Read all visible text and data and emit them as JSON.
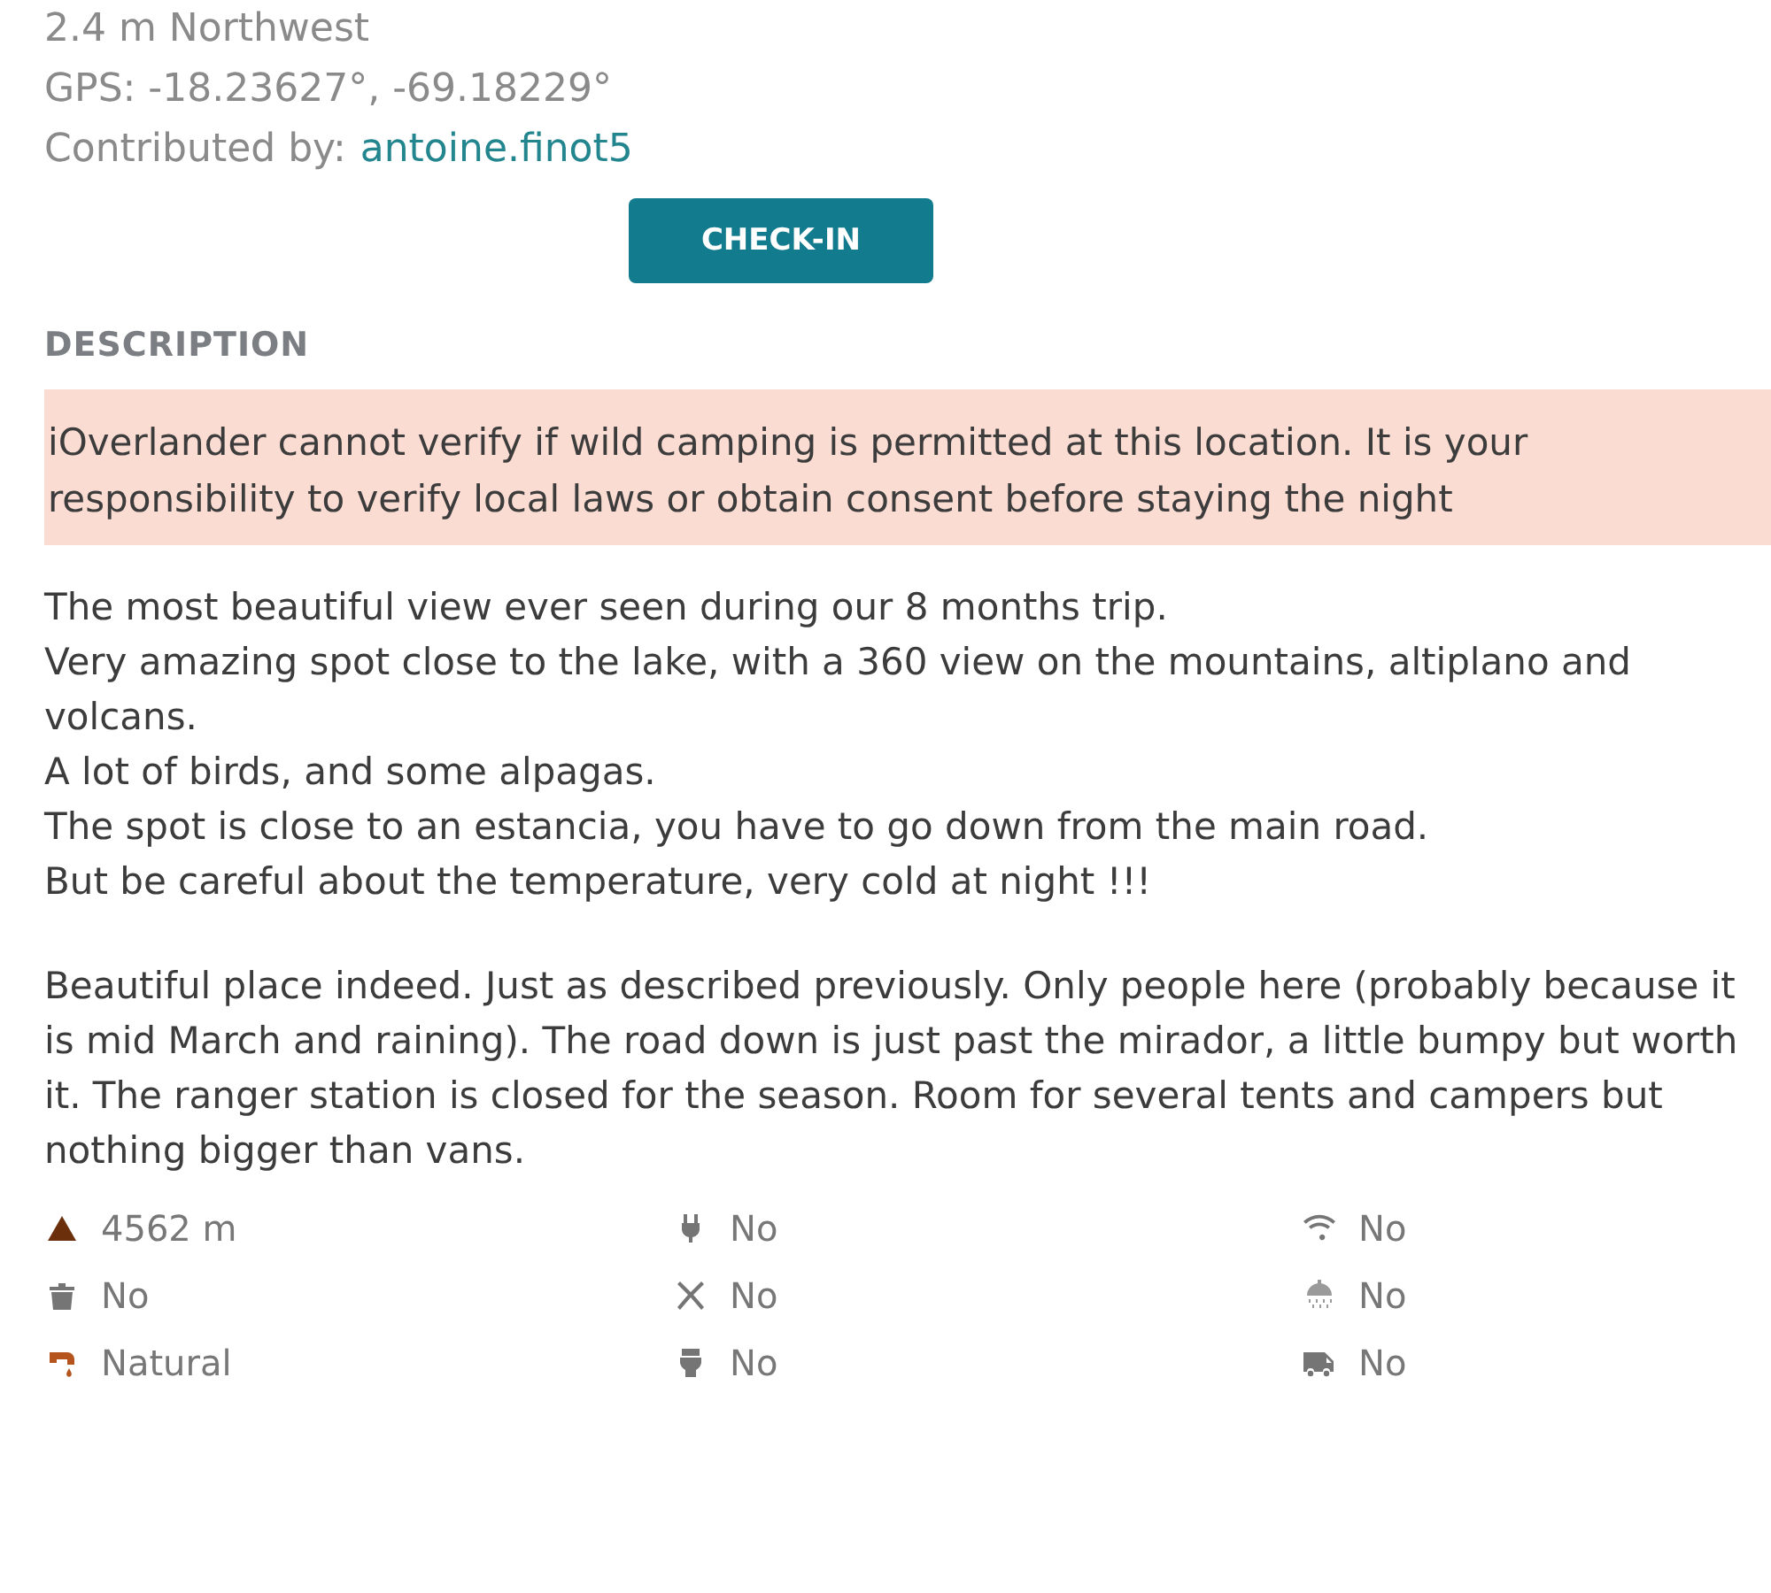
{
  "location": {
    "distance": "2.4 m Northwest",
    "gps": "GPS: -18.23627°, -69.18229°",
    "contributed_label": "Contributed by:",
    "contributor": "antoine.finot5"
  },
  "checkin_button": "CHECK-IN",
  "description_heading": "DESCRIPTION",
  "warning": "iOverlander cannot verify if wild camping is permitted at this location. It is your responsibility to verify local laws or obtain consent before staying the night",
  "description_lines": [
    "The most beautiful view ever seen during our 8 months trip.",
    "Very amazing spot close to the lake, with a 360 view on the mountains, altiplano and volcans.",
    "A lot of birds, and some alpagas.",
    "The spot is close to an estancia, you have to go down from the main road.",
    "But be careful about the temperature, very cold at night !!!"
  ],
  "comment": "Beautiful place indeed. Just as described previously. Only people here (probably because it is mid March and raining). The road down is just past the mirador, a little bumpy but worth it. The ranger station is closed for the season. Room for several tents and campers but nothing bigger than vans.",
  "amenities": [
    {
      "kind": "elevation",
      "color": "#6b2f0c",
      "text": "4562 m"
    },
    {
      "kind": "electricity",
      "color": "#757575",
      "text": "No"
    },
    {
      "kind": "wifi",
      "color": "#757575",
      "text": "No"
    },
    {
      "kind": "trash",
      "color": "#757575",
      "text": "No"
    },
    {
      "kind": "kitchen",
      "color": "#757575",
      "text": "No"
    },
    {
      "kind": "shower",
      "color": "#9a9a9a",
      "text": "No"
    },
    {
      "kind": "water",
      "color": "#b5541c",
      "text": "Natural"
    },
    {
      "kind": "toilet",
      "color": "#757575",
      "text": "No"
    },
    {
      "kind": "rv",
      "color": "#757575",
      "text": "No"
    }
  ]
}
